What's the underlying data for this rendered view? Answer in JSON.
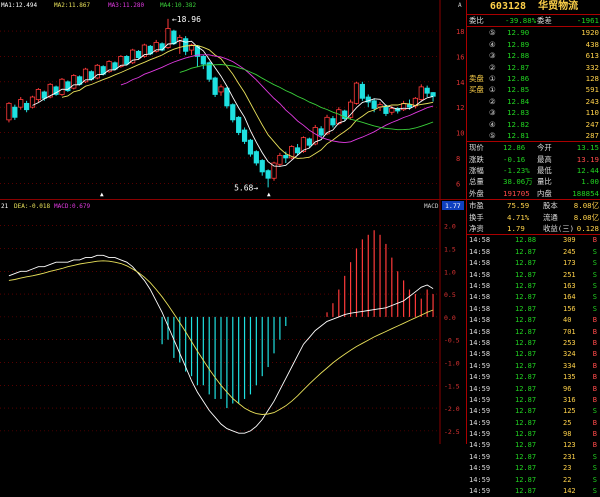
{
  "stock": {
    "code": "603128",
    "name": "华贸物流"
  },
  "ma_legend": {
    "ma1": "MA1:12.494",
    "ma2": "MA2:11.867",
    "ma3": "MA3:11.280",
    "ma4": "MA4:10.382"
  },
  "annotations": {
    "high": "18.96",
    "low": "5.68"
  },
  "macd_legend": {
    "dif": "21",
    "dea": "DEA:-0.018",
    "macd": "MACD:0.679",
    "tag": "MACD",
    "value": "1.77"
  },
  "top_right_tag": "A",
  "price_axis": [
    "18",
    "16",
    "14",
    "12",
    "10",
    "8",
    "6"
  ],
  "macd_axis": [
    "2.0",
    "1.5",
    "1.0",
    "0.5",
    "0.0",
    "-0.5",
    "-1.0",
    "-1.5",
    "-2.0",
    "-2.5"
  ],
  "colors": {
    "up": "#ff3a3a",
    "down": "#1fe0e0",
    "ma1": "#ffffff",
    "ma2": "#e8e05a",
    "ma3": "#e03ae0",
    "ma4": "#3ad03a",
    "grid": "#8a0000"
  },
  "quote": {
    "weibi": {
      "label": "委比",
      "value": "-39.88%",
      "label2": "委差",
      "value2": "-1961"
    },
    "sell": [
      {
        "idx": "⑤",
        "price": "12.90",
        "vol": "1920"
      },
      {
        "idx": "④",
        "price": "12.89",
        "vol": "438"
      },
      {
        "idx": "③",
        "price": "12.88",
        "vol": "613"
      },
      {
        "idx": "②",
        "price": "12.87",
        "vol": "332"
      },
      {
        "idx": "①",
        "price": "12.86",
        "vol": "128",
        "label": "卖盘"
      }
    ],
    "buy": [
      {
        "idx": "①",
        "price": "12.85",
        "vol": "591",
        "label": "买盘"
      },
      {
        "idx": "②",
        "price": "12.84",
        "vol": "243"
      },
      {
        "idx": "③",
        "price": "12.83",
        "vol": "110"
      },
      {
        "idx": "④",
        "price": "12.82",
        "vol": "247"
      },
      {
        "idx": "⑤",
        "price": "12.81",
        "vol": "287"
      }
    ],
    "stats": [
      {
        "l1": "现价",
        "v1": "12.86",
        "l2": "今开",
        "v2": "13.15"
      },
      {
        "l1": "涨跌",
        "v1": "-0.16",
        "l2": "最高",
        "v2": "13.19"
      },
      {
        "l1": "涨幅",
        "v1": "-1.23%",
        "l2": "最低",
        "v2": "12.44"
      },
      {
        "l1": "总量",
        "v1": "38.06万",
        "l2": "量比",
        "v2": "1.00"
      },
      {
        "l1": "外盘",
        "v1": "191705",
        "l2": "内盘",
        "v2": "188854"
      }
    ],
    "fundamentals": [
      {
        "l1": "市盈",
        "v1": "75.59",
        "l2": "股本",
        "v2": "8.08亿"
      },
      {
        "l1": "换手",
        "v1": "4.71%",
        "l2": "流通",
        "v2": "8.08亿"
      },
      {
        "l1": "净资",
        "v1": "1.79",
        "l2": "收益(三)",
        "v2": "0.128"
      }
    ],
    "ticks": [
      {
        "t": "14:58",
        "p": "12.88",
        "v": "309",
        "s": "B"
      },
      {
        "t": "14:58",
        "p": "12.87",
        "v": "245",
        "s": "S"
      },
      {
        "t": "14:58",
        "p": "12.87",
        "v": "173",
        "s": "S"
      },
      {
        "t": "14:58",
        "p": "12.87",
        "v": "251",
        "s": "S"
      },
      {
        "t": "14:58",
        "p": "12.87",
        "v": "163",
        "s": "S"
      },
      {
        "t": "14:58",
        "p": "12.87",
        "v": "164",
        "s": "S"
      },
      {
        "t": "14:58",
        "p": "12.87",
        "v": "156",
        "s": "S"
      },
      {
        "t": "14:58",
        "p": "12.87",
        "v": "40",
        "s": "B"
      },
      {
        "t": "14:58",
        "p": "12.87",
        "v": "701",
        "s": "B"
      },
      {
        "t": "14:58",
        "p": "12.87",
        "v": "253",
        "s": "B"
      },
      {
        "t": "14:58",
        "p": "12.87",
        "v": "324",
        "s": "B"
      },
      {
        "t": "14:59",
        "p": "12.87",
        "v": "334",
        "s": "B"
      },
      {
        "t": "14:59",
        "p": "12.87",
        "v": "135",
        "s": "B"
      },
      {
        "t": "14:59",
        "p": "12.87",
        "v": "96",
        "s": "B"
      },
      {
        "t": "14:59",
        "p": "12.87",
        "v": "316",
        "s": "B"
      },
      {
        "t": "14:59",
        "p": "12.87",
        "v": "125",
        "s": "S"
      },
      {
        "t": "14:59",
        "p": "12.87",
        "v": "25",
        "s": "B"
      },
      {
        "t": "14:59",
        "p": "12.87",
        "v": "98",
        "s": "B"
      },
      {
        "t": "14:59",
        "p": "12.87",
        "v": "123",
        "s": "B"
      },
      {
        "t": "14:59",
        "p": "12.87",
        "v": "231",
        "s": "S"
      },
      {
        "t": "14:59",
        "p": "12.87",
        "v": "23",
        "s": "S"
      },
      {
        "t": "14:59",
        "p": "12.87",
        "v": "22",
        "s": "S"
      },
      {
        "t": "14:59",
        "p": "12.87",
        "v": "142",
        "s": "S"
      }
    ]
  },
  "chart_data": {
    "type": "candlestick",
    "price_range": [
      5,
      19.5
    ],
    "candles": [
      [
        11.0,
        12.3,
        10.8,
        12.4
      ],
      [
        12.0,
        11.2,
        11.0,
        12.2
      ],
      [
        12.0,
        12.6,
        11.8,
        12.8
      ],
      [
        12.3,
        11.8,
        11.6,
        12.5
      ],
      [
        12.0,
        12.8,
        11.9,
        12.9
      ],
      [
        12.6,
        13.4,
        12.4,
        13.5
      ],
      [
        13.2,
        12.7,
        12.5,
        13.3
      ],
      [
        12.8,
        13.8,
        12.7,
        13.9
      ],
      [
        13.6,
        13.0,
        12.9,
        13.7
      ],
      [
        13.0,
        14.2,
        12.9,
        14.3
      ],
      [
        14.0,
        13.3,
        13.2,
        14.1
      ],
      [
        13.5,
        14.5,
        13.4,
        14.6
      ],
      [
        14.4,
        13.8,
        13.7,
        14.5
      ],
      [
        14.0,
        15.0,
        13.9,
        15.1
      ],
      [
        14.8,
        14.2,
        14.1,
        14.9
      ],
      [
        14.3,
        15.3,
        14.2,
        15.4
      ],
      [
        15.2,
        14.6,
        14.5,
        15.3
      ],
      [
        14.8,
        15.6,
        14.7,
        15.7
      ],
      [
        15.5,
        15.0,
        14.9,
        15.6
      ],
      [
        15.2,
        16.0,
        15.1,
        16.1
      ],
      [
        16.0,
        15.4,
        15.3,
        16.1
      ],
      [
        15.5,
        16.5,
        15.4,
        16.6
      ],
      [
        16.4,
        15.9,
        15.8,
        16.5
      ],
      [
        16.0,
        16.9,
        15.9,
        17.0
      ],
      [
        16.8,
        16.2,
        16.1,
        16.9
      ],
      [
        16.4,
        17.1,
        16.3,
        17.3
      ],
      [
        17.0,
        16.5,
        16.4,
        17.1
      ],
      [
        16.7,
        18.2,
        16.6,
        18.96
      ],
      [
        18.0,
        17.0,
        16.9,
        18.1
      ],
      [
        17.2,
        17.5,
        16.2,
        17.7
      ],
      [
        17.4,
        16.4,
        16.1,
        17.6
      ],
      [
        16.5,
        16.9,
        16.1,
        17.0
      ],
      [
        16.8,
        16.0,
        15.2,
        16.9
      ],
      [
        16.0,
        15.4,
        15.0,
        16.1
      ],
      [
        15.5,
        14.2,
        14.0,
        15.6
      ],
      [
        14.3,
        13.0,
        12.8,
        14.4
      ],
      [
        13.2,
        13.6,
        12.9,
        13.8
      ],
      [
        13.5,
        12.1,
        11.9,
        13.6
      ],
      [
        12.2,
        11.0,
        10.8,
        12.3
      ],
      [
        11.2,
        10.0,
        9.8,
        11.3
      ],
      [
        10.2,
        9.3,
        9.1,
        10.4
      ],
      [
        9.4,
        8.3,
        8.1,
        9.5
      ],
      [
        8.5,
        7.6,
        7.4,
        8.6
      ],
      [
        7.8,
        6.9,
        6.6,
        7.9
      ],
      [
        7.0,
        6.4,
        5.68,
        7.1
      ],
      [
        6.4,
        7.6,
        6.2,
        7.7
      ],
      [
        7.5,
        8.2,
        7.3,
        8.4
      ],
      [
        8.2,
        8.0,
        7.6,
        8.5
      ],
      [
        8.0,
        8.9,
        7.9,
        9.0
      ],
      [
        8.8,
        8.4,
        8.2,
        9.1
      ],
      [
        8.5,
        9.6,
        8.4,
        9.7
      ],
      [
        9.5,
        9.0,
        8.8,
        9.6
      ],
      [
        9.1,
        10.4,
        9.0,
        10.6
      ],
      [
        10.3,
        9.8,
        9.6,
        10.5
      ],
      [
        9.9,
        11.2,
        9.8,
        11.4
      ],
      [
        11.1,
        10.6,
        10.4,
        11.3
      ],
      [
        10.7,
        11.8,
        10.6,
        12.0
      ],
      [
        11.7,
        11.1,
        10.9,
        11.8
      ],
      [
        11.2,
        12.4,
        11.0,
        12.6
      ],
      [
        12.3,
        13.9,
        12.2,
        14.0
      ],
      [
        13.8,
        12.7,
        12.5,
        14.0
      ],
      [
        12.8,
        12.4,
        12.0,
        13.0
      ],
      [
        12.5,
        11.9,
        11.6,
        12.7
      ],
      [
        12.0,
        12.2,
        11.7,
        12.4
      ],
      [
        12.1,
        11.5,
        11.3,
        12.2
      ],
      [
        11.6,
        11.9,
        11.4,
        12.1
      ],
      [
        11.9,
        11.7,
        11.5,
        12.0
      ],
      [
        11.8,
        12.3,
        11.7,
        12.5
      ],
      [
        12.2,
        12.0,
        11.8,
        12.6
      ],
      [
        12.1,
        12.7,
        11.9,
        12.8
      ],
      [
        12.6,
        13.6,
        12.5,
        13.8
      ],
      [
        13.5,
        13.1,
        12.8,
        13.7
      ],
      [
        13.15,
        12.86,
        12.44,
        13.19
      ]
    ],
    "macd_range": [
      -2.7,
      2.3
    ],
    "macd_bars": [
      0.0,
      0.0,
      0.0,
      0.0,
      0.0,
      0.0,
      0.0,
      0.0,
      0.0,
      0.0,
      0.0,
      0.0,
      0.0,
      0.0,
      0.0,
      0.0,
      0.0,
      0.0,
      0.0,
      0.0,
      0.0,
      0.0,
      0.0,
      0.0,
      0.0,
      0.0,
      -0.6,
      -0.5,
      -0.9,
      -1.0,
      -1.2,
      -1.3,
      -1.5,
      -1.5,
      -1.7,
      -1.8,
      -1.8,
      -2.0,
      -1.9,
      -1.9,
      -1.8,
      -1.7,
      -1.5,
      -1.3,
      -1.1,
      -0.8,
      -0.5,
      -0.2,
      0.0,
      0.0,
      0.0,
      0.0,
      0.0,
      0.0,
      0.1,
      0.3,
      0.6,
      0.9,
      1.2,
      1.5,
      1.7,
      1.8,
      1.9,
      1.8,
      1.6,
      1.3,
      1.0,
      0.8,
      0.6,
      0.5,
      0.4,
      0.6,
      0.5
    ],
    "dif": [
      0.9,
      0.95,
      1.0,
      1.0,
      1.05,
      1.1,
      1.1,
      1.15,
      1.2,
      1.2,
      1.2,
      1.25,
      1.25,
      1.3,
      1.3,
      1.35,
      1.35,
      1.3,
      1.3,
      1.25,
      1.2,
      1.1,
      0.95,
      0.8,
      0.6,
      0.35,
      0.1,
      -0.2,
      -0.5,
      -0.8,
      -1.1,
      -1.4,
      -1.65,
      -1.85,
      -2.05,
      -2.2,
      -2.35,
      -2.45,
      -2.5,
      -2.55,
      -2.55,
      -2.5,
      -2.4,
      -2.25,
      -2.05,
      -1.85,
      -1.6,
      -1.35,
      -1.1,
      -0.85,
      -0.6,
      -0.45,
      -0.3,
      -0.2,
      -0.1,
      -0.05,
      0.0,
      0.05,
      0.08,
      0.1,
      0.12,
      0.14,
      0.16,
      0.18,
      0.2,
      0.25,
      0.3,
      0.35,
      0.45,
      0.55,
      0.65,
      0.7,
      0.62
    ],
    "dea": [
      0.8,
      0.82,
      0.85,
      0.88,
      0.9,
      0.93,
      0.96,
      1.0,
      1.03,
      1.06,
      1.1,
      1.13,
      1.16,
      1.18,
      1.2,
      1.22,
      1.23,
      1.22,
      1.2,
      1.17,
      1.12,
      1.05,
      0.97,
      0.87,
      0.75,
      0.6,
      0.44,
      0.26,
      0.07,
      -0.13,
      -0.33,
      -0.54,
      -0.75,
      -0.95,
      -1.15,
      -1.33,
      -1.5,
      -1.65,
      -1.79,
      -1.9,
      -2.0,
      -2.07,
      -2.12,
      -2.14,
      -2.13,
      -2.1,
      -2.03,
      -1.95,
      -1.85,
      -1.73,
      -1.6,
      -1.47,
      -1.35,
      -1.23,
      -1.12,
      -1.01,
      -0.91,
      -0.82,
      -0.73,
      -0.65,
      -0.58,
      -0.51,
      -0.44,
      -0.38,
      -0.32,
      -0.26,
      -0.2,
      -0.14,
      -0.08,
      -0.02,
      0.04,
      0.1,
      0.15
    ]
  }
}
